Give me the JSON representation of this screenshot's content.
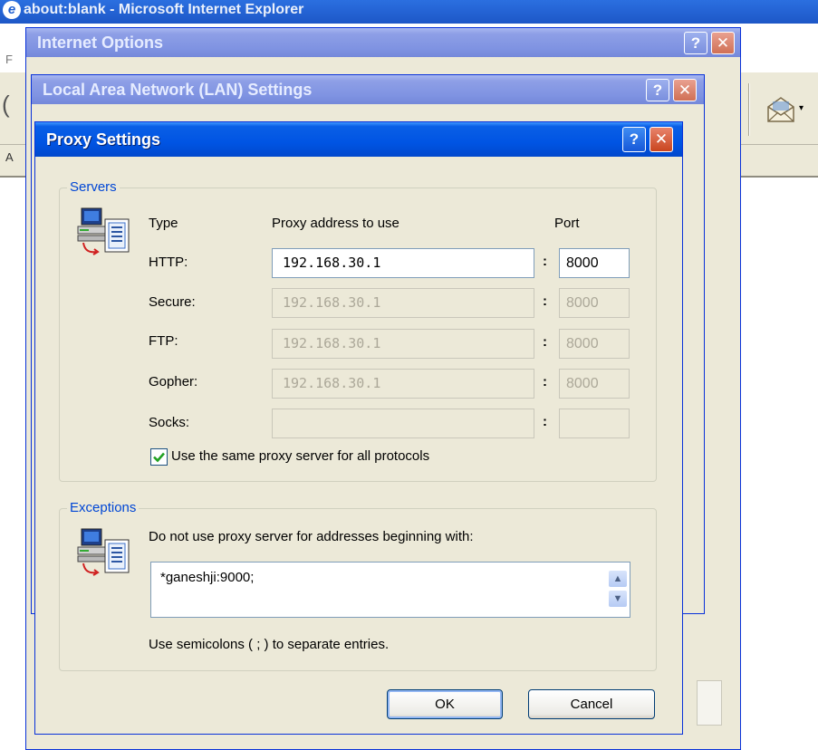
{
  "browser": {
    "title": "about:blank - Microsoft Internet Explorer",
    "menu_initial": "F",
    "address_initial": "A"
  },
  "internet_options": {
    "title": "Internet Options"
  },
  "lan_settings": {
    "title": "Local Area Network (LAN) Settings"
  },
  "proxy_settings": {
    "title": "Proxy Settings",
    "title_buttons": {
      "help": "?",
      "close": "✕"
    },
    "servers": {
      "legend": "Servers",
      "col_type": "Type",
      "col_address": "Proxy address to use",
      "col_port": "Port",
      "separator": ":",
      "rows": [
        {
          "label": "HTTP:",
          "address": "192.168.30.1",
          "port": "8000",
          "enabled": true
        },
        {
          "label": "Secure:",
          "address": "192.168.30.1",
          "port": "8000",
          "enabled": false
        },
        {
          "label": "FTP:",
          "address": "192.168.30.1",
          "port": "8000",
          "enabled": false
        },
        {
          "label": "Gopher:",
          "address": "192.168.30.1",
          "port": "8000",
          "enabled": false
        },
        {
          "label": "Socks:",
          "address": "",
          "port": "",
          "enabled": false
        }
      ],
      "same_proxy_label": "Use the same proxy server for all protocols",
      "same_proxy_checked": true
    },
    "exceptions": {
      "legend": "Exceptions",
      "description": "Do not use proxy server for addresses beginning with:",
      "value": "*ganeshji:9000;",
      "hint": "Use semicolons ( ; ) to separate entries."
    },
    "buttons": {
      "ok": "OK",
      "cancel": "Cancel"
    }
  },
  "icons": [
    "ie-logo-icon",
    "mail-icon",
    "network-computer-icon",
    "help-icon",
    "close-icon",
    "checkmark-icon",
    "scroll-up-icon",
    "scroll-down-icon"
  ],
  "colors": {
    "title_active": "#0054e3",
    "title_inactive": "#7f93e2",
    "dialog_face": "#ece9d8",
    "legend_text": "#0046d5",
    "close_button": "#c9451f",
    "field_border": "#7f9db9"
  }
}
